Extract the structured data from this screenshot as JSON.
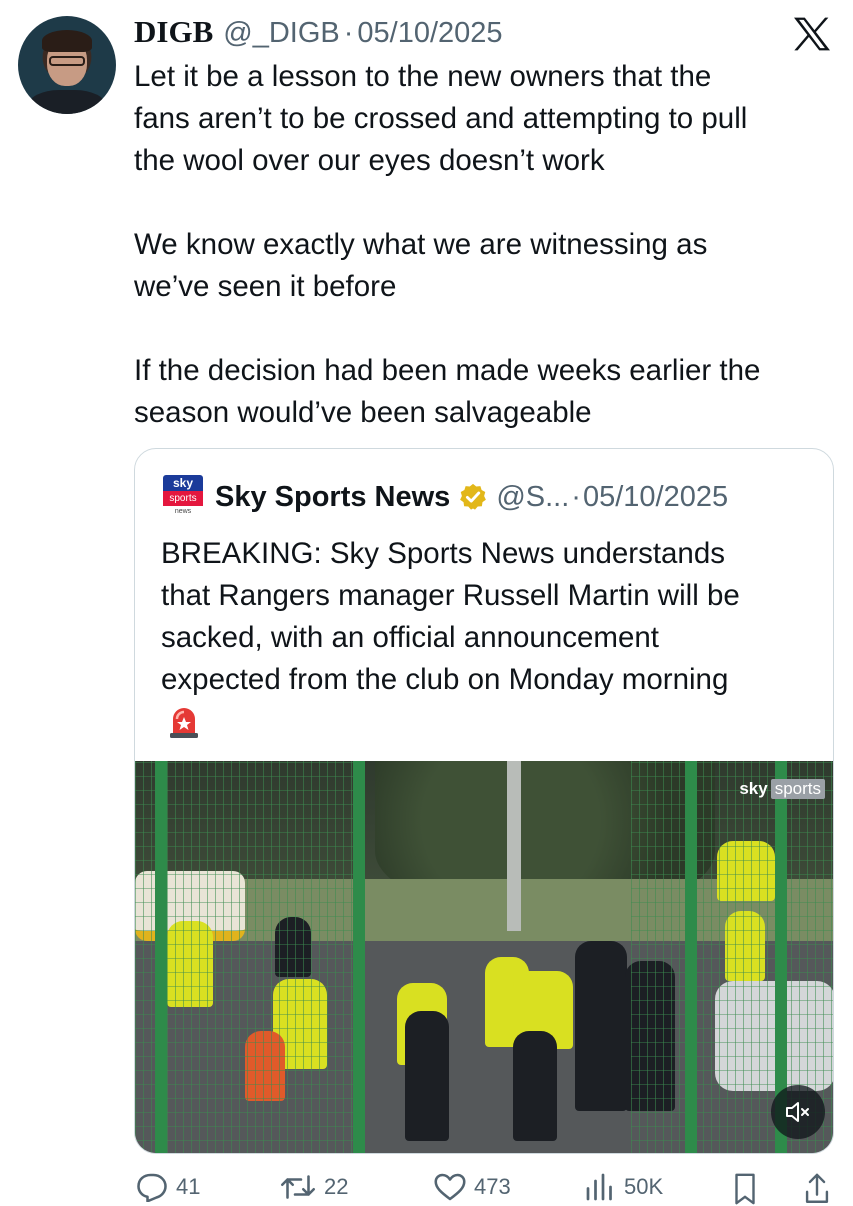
{
  "tweet": {
    "author_name": "DIGB",
    "author_handle": "@_DIGB",
    "separator": "·",
    "date": "05/10/2025",
    "text": "Let it be a lesson to the new owners that the\nfans aren’t to be crossed and attempting to pull\nthe wool over our eyes doesn’t work\n\nWe know exactly what we are witnessing as\nwe’ve seen it before\n\nIf the decision had been made weeks earlier the\nseason would’ve been salvageable"
  },
  "quoted": {
    "logo_top": "sky",
    "logo_mid": "sports",
    "logo_bottom": "news",
    "author_name": "Sky Sports News",
    "author_handle": "@S...",
    "separator": "·",
    "date": "05/10/2025",
    "text": "BREAKING: Sky Sports News understands\nthat Rangers manager Russell Martin will be\nsacked, with an official announcement\nexpected from the club on Monday morning",
    "emoji_icon": "police-siren-icon",
    "media": {
      "watermark_left": "sky",
      "watermark_right": "sports"
    }
  },
  "actions": {
    "replies": "41",
    "reposts": "22",
    "likes": "473",
    "views": "50K"
  },
  "colors": {
    "text": "#0f1419",
    "secondary": "#536471",
    "border": "#cfd9de",
    "verified_gold": "#e2b719"
  }
}
